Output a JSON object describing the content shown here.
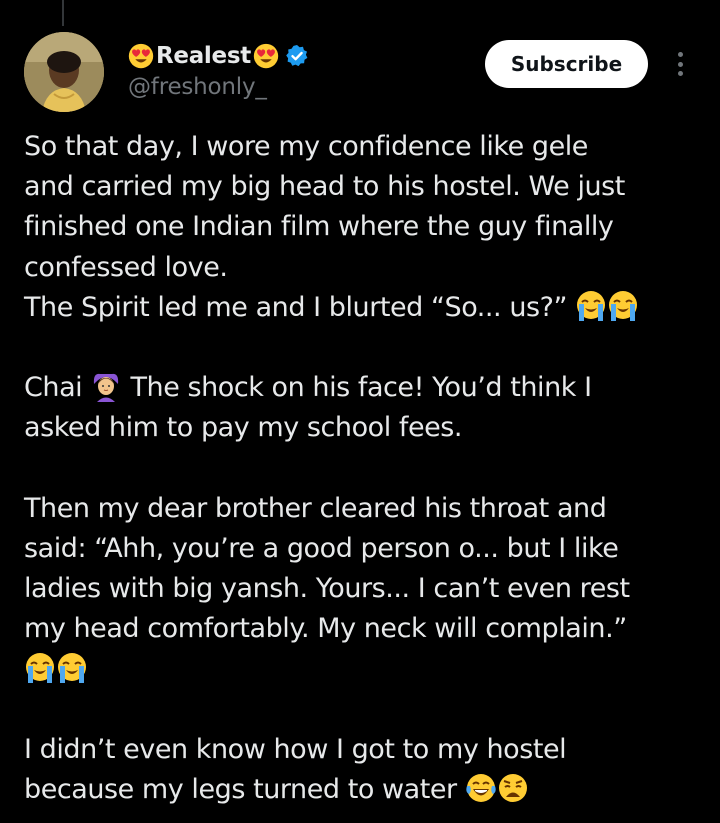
{
  "author": {
    "display_name": "Realest",
    "handle": "@freshonly_",
    "name_prefix_emoji": "heart-eyes-emoji",
    "name_suffix_emoji": "heart-eyes-emoji",
    "verified": true
  },
  "actions": {
    "subscribe_label": "Subscribe",
    "more_icon": "more-vertical-icon"
  },
  "tweet": {
    "p1_l1": "So that day, I wore my confidence like gele",
    "p1_l2": "and carried my big head to his hostel. We just",
    "p1_l3": "finished one Indian film where the guy finally",
    "p1_l4": "confessed love.",
    "p1_l5": "The Spirit led me and I blurted “So... us?”",
    "p2_l1a": "Chai",
    "p2_l1b": "The shock on his face! You’d think I",
    "p2_l2": "asked him to pay my school fees.",
    "p3_l1": "Then my dear brother cleared his throat and",
    "p3_l2": "said: “Ahh, you’re a good person o... but I like",
    "p3_l3": "ladies with big yansh. Yours... I can’t even rest",
    "p3_l4": "my head comfortably. My neck will complain.”",
    "p4_l1": "I didn’t even know how I got to my hostel",
    "p4_l2": "because my legs turned to water"
  },
  "colors": {
    "background": "#000000",
    "text": "#e7e9ea",
    "secondary": "#71767b",
    "verified": "#1d9bf0",
    "subscribe_bg": "#ffffff"
  }
}
